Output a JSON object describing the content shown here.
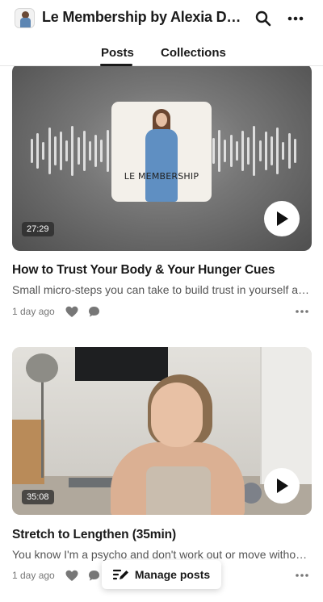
{
  "header": {
    "title": "Le Membership by Alexia Degremont",
    "tabs": [
      {
        "label": "Posts",
        "active": true
      },
      {
        "label": "Collections",
        "active": false
      }
    ]
  },
  "posts": [
    {
      "title": "How to Trust Your Body & Your Hunger Cues",
      "subtitle": "Small micro-steps you can take to build trust in yourself and your body",
      "duration": "27:29",
      "time": "1 day ago",
      "media": "audio",
      "cover_text": "LE MEMBERSHIP"
    },
    {
      "title": "Stretch to Lengthen (35min)",
      "subtitle": "You know I'm a psycho and don't work out or move without music",
      "duration": "35:08",
      "time": "1 day ago",
      "media": "video"
    }
  ],
  "footer": {
    "manage_label": "Manage posts"
  },
  "colors": {
    "text": "#1a1a1a",
    "muted": "#777777",
    "accent_script": "#a8c48a"
  }
}
